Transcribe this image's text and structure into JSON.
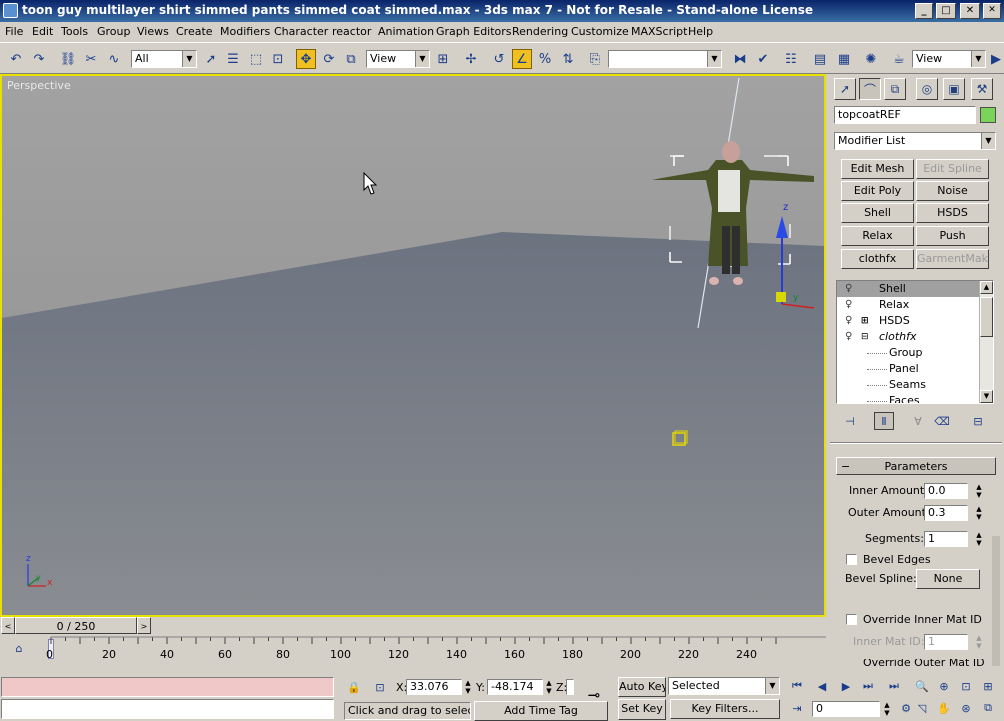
{
  "window": {
    "title": "toon guy multilayer shirt simmed pants simmed coat simmed.max - 3ds max 7  - Not for Resale - Stand-alone License",
    "minimize": "_",
    "maximize": "□",
    "close": "✕"
  },
  "menu": [
    "File",
    "Edit",
    "Tools",
    "Group",
    "Views",
    "Create",
    "Modifiers",
    "Character",
    "reactor",
    "Animation",
    "Graph Editors",
    "Rendering",
    "Customize",
    "MAXScript",
    "Help"
  ],
  "toolbar": {
    "selection_filter": "All",
    "ref_coord": "View",
    "named_selection": "",
    "right_coord": "View"
  },
  "viewport": {
    "label": "Perspective",
    "axis_x": "x",
    "axis_y": "y",
    "axis_z": "z"
  },
  "command_panel": {
    "object_name": "topcoatREF",
    "object_color": "#7bd35a",
    "modifier_list": "Modifier List",
    "modifier_buttons": [
      {
        "label": "Edit Mesh",
        "enabled": true
      },
      {
        "label": "Edit Spline",
        "enabled": false
      },
      {
        "label": "Edit Poly",
        "enabled": true
      },
      {
        "label": "Noise",
        "enabled": true
      },
      {
        "label": "Shell",
        "enabled": true
      },
      {
        "label": "HSDS",
        "enabled": true
      },
      {
        "label": "Relax",
        "enabled": true
      },
      {
        "label": "Push",
        "enabled": true
      },
      {
        "label": "clothfx",
        "enabled": true
      },
      {
        "label": "GarmentMaker",
        "enabled": false
      }
    ],
    "stack": [
      {
        "label": "Shell",
        "selected": true
      },
      {
        "label": "Relax",
        "selected": false
      },
      {
        "label": "HSDS",
        "selected": false
      },
      {
        "label": "clothfx",
        "selected": false
      },
      {
        "label": "Group",
        "selected": false
      },
      {
        "label": "Panel",
        "selected": false
      },
      {
        "label": "Seams",
        "selected": false
      },
      {
        "label": "Faces",
        "selected": false
      }
    ],
    "rollout_title": "Parameters",
    "inner_amount_label": "Inner Amount:",
    "inner_amount": "0.0",
    "outer_amount_label": "Outer Amount:",
    "outer_amount": "0.3",
    "segments_label": "Segments:",
    "segments": "1",
    "bevel_edges_label": "Bevel Edges",
    "bevel_spline_label": "Bevel Spline:",
    "bevel_spline_value": "None",
    "override_inner_label": "Override Inner Mat ID",
    "inner_mat_id_label": "Inner Mat ID:",
    "inner_mat_id": "1",
    "override_outer_label": "Override Outer Mat ID"
  },
  "timeline": {
    "frame_display": "0 / 250",
    "ticks": [
      "0",
      "20",
      "40",
      "60",
      "80",
      "100",
      "120",
      "140",
      "160",
      "180",
      "200",
      "220",
      "240"
    ]
  },
  "status": {
    "x_label": "X:",
    "x_value": "33.076",
    "y_label": "Y:",
    "y_value": "-48.174",
    "z_label": "Z:",
    "prompt": "Click and drag to select ar",
    "add_time_tag": "Add Time Tag",
    "auto_key": "Auto Key",
    "set_key": "Set Key",
    "key_mode": "Selected",
    "key_filters": "Key Filters...",
    "current_frame": "0"
  }
}
